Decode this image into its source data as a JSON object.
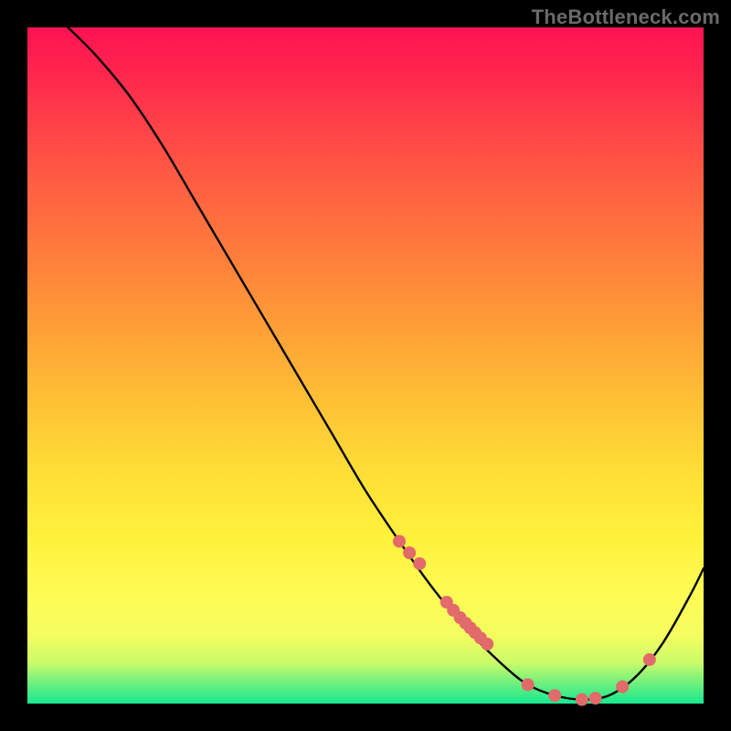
{
  "watermark_text": "TheBottleneck.com",
  "chart_data": {
    "type": "line",
    "title": "",
    "xlabel": "",
    "ylabel": "",
    "xlim": [
      0,
      100
    ],
    "ylim": [
      0,
      100
    ],
    "grid": false,
    "legend": false,
    "background_gradient_stops": [
      {
        "pos": 0,
        "color": "#ff1252"
      },
      {
        "pos": 8,
        "color": "#ff2a4d"
      },
      {
        "pos": 16,
        "color": "#ff4747"
      },
      {
        "pos": 26,
        "color": "#ff6740"
      },
      {
        "pos": 36,
        "color": "#ff843a"
      },
      {
        "pos": 46,
        "color": "#ffa436"
      },
      {
        "pos": 56,
        "color": "#ffc235"
      },
      {
        "pos": 66,
        "color": "#ffdf37"
      },
      {
        "pos": 76,
        "color": "#fff23d"
      },
      {
        "pos": 84,
        "color": "#fffb55"
      },
      {
        "pos": 90,
        "color": "#f4fd60"
      },
      {
        "pos": 94,
        "color": "#c9fb6a"
      },
      {
        "pos": 97,
        "color": "#6ef07e"
      },
      {
        "pos": 100,
        "color": "#17e88f"
      }
    ],
    "series": [
      {
        "name": "bottleneck-curve",
        "color": "#000000",
        "stroke_width": 2,
        "x": [
          6,
          10,
          15,
          20,
          25,
          30,
          35,
          40,
          45,
          50,
          55,
          60,
          65,
          70,
          74,
          78,
          82,
          86,
          90,
          94,
          98,
          100
        ],
        "y": [
          100,
          96,
          90,
          82.5,
          74,
          65.5,
          57,
          48.5,
          40,
          31.5,
          24,
          17,
          11,
          6,
          2.8,
          1.2,
          0.6,
          1.2,
          4,
          9,
          16,
          20
        ]
      }
    ],
    "highlight_points": {
      "name": "highlight-dots",
      "color": "#e26a6a",
      "radius": 7,
      "x": [
        55,
        56.5,
        58,
        62,
        63,
        64,
        64.8,
        65.5,
        66.2,
        67,
        68,
        74,
        78,
        82,
        84,
        88,
        92
      ],
      "y": [
        24,
        22.3,
        20.7,
        15,
        13.8,
        12.7,
        11.9,
        11.2,
        10.5,
        9.7,
        8.8,
        2.8,
        1.2,
        0.6,
        0.8,
        2.5,
        6.5
      ]
    }
  }
}
